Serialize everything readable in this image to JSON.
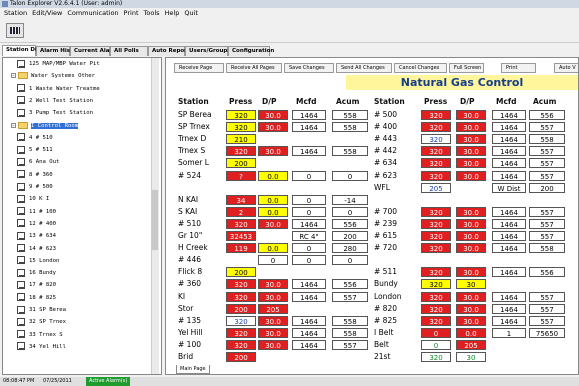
{
  "window": {
    "title": "Talon Explorer V2.6.4.1 (User: admin)"
  },
  "menu": [
    "Station",
    "Edit/View",
    "Communication",
    "Print",
    "Tools",
    "Help",
    "Quit"
  ],
  "tabs": [
    "Station Display",
    "Alarm History",
    "Current Alarms",
    "All Polls",
    "Auto Reports",
    "Users/Groups",
    "Configuration"
  ],
  "tree": [
    {
      "label": "125 MAP/MBP Water Pit",
      "level": 2,
      "type": "node"
    },
    {
      "label": "Water Systems Other",
      "level": 1,
      "type": "folder"
    },
    {
      "label": "1 Waste Water Treatme",
      "level": 2,
      "type": "node"
    },
    {
      "label": "2 Well Test Station",
      "level": 2,
      "type": "node"
    },
    {
      "label": "3 Pump Test Station",
      "level": 2,
      "type": "node"
    },
    {
      "label": "I Control Room",
      "level": 1,
      "type": "folder",
      "selected": true
    },
    {
      "label": "4 # 510",
      "level": 2,
      "type": "node"
    },
    {
      "label": "5 # 511",
      "level": 2,
      "type": "node"
    },
    {
      "label": "6 Ana Out",
      "level": 2,
      "type": "node"
    },
    {
      "label": "8 # 360",
      "level": 2,
      "type": "node"
    },
    {
      "label": "9 # 500",
      "level": 2,
      "type": "node"
    },
    {
      "label": "10 K I",
      "level": 2,
      "type": "node"
    },
    {
      "label": "11 # 100",
      "level": 2,
      "type": "node"
    },
    {
      "label": "12 # 400",
      "level": 2,
      "type": "node"
    },
    {
      "label": "13 # 634",
      "level": 2,
      "type": "node"
    },
    {
      "label": "14 # 623",
      "level": 2,
      "type": "node"
    },
    {
      "label": "15 London",
      "level": 2,
      "type": "node"
    },
    {
      "label": "16 Bundy",
      "level": 2,
      "type": "node"
    },
    {
      "label": "17 # 820",
      "level": 2,
      "type": "node"
    },
    {
      "label": "18 # 825",
      "level": 2,
      "type": "node"
    },
    {
      "label": "31 SP Berea",
      "level": 2,
      "type": "node"
    },
    {
      "label": "32 SP Trnex",
      "level": 2,
      "type": "node"
    },
    {
      "label": "33 Trnex S",
      "level": 2,
      "type": "node"
    },
    {
      "label": "34 Yel Hill",
      "level": 2,
      "type": "node"
    }
  ],
  "panel_buttons": [
    "Receive Page",
    "Receive All Pages",
    "Save Changes",
    "Send All Changes",
    "Cancel Changes",
    "Full Screen",
    "Print",
    "Auto V"
  ],
  "panel_title": "Natural Gas Control",
  "headers": [
    "Station",
    "Press",
    "D/P",
    "Mcfd",
    "Acum"
  ],
  "left_rows": [
    {
      "name": "SP Berea",
      "press": "320",
      "pc": "yel",
      "dp": "30.0",
      "dc": "red",
      "mcfd": "1464",
      "acum": "558"
    },
    {
      "name": "SP Trnex",
      "press": "320",
      "pc": "yel",
      "dp": "30.0",
      "dc": "red",
      "mcfd": "1464",
      "acum": "558"
    },
    {
      "name": "Trnex D",
      "press": "210",
      "pc": "yel",
      "dp": "",
      "dc": "",
      "mcfd": "",
      "acum": ""
    },
    {
      "name": "Trnex S",
      "press": "320",
      "pc": "red",
      "dp": "30.0",
      "dc": "red",
      "mcfd": "1464",
      "acum": "558"
    },
    {
      "name": "Somer L",
      "press": "200",
      "pc": "yel",
      "dp": "",
      "dc": "",
      "mcfd": "",
      "acum": ""
    },
    {
      "name": "# 524",
      "press": "?",
      "pc": "red",
      "dp": "0.0",
      "dc": "yel",
      "mcfd": "0",
      "acum": "0"
    },
    {
      "name": "",
      "press": "",
      "pc": "",
      "dp": "",
      "dc": "",
      "mcfd": "",
      "acum": ""
    },
    {
      "name": "N KAI",
      "press": "34",
      "pc": "red",
      "dp": "0.0",
      "dc": "yel",
      "mcfd": "0",
      "acum": "-14"
    },
    {
      "name": "S KAI",
      "press": "2",
      "pc": "red",
      "dp": "0.0",
      "dc": "yel",
      "mcfd": "0",
      "acum": "0"
    },
    {
      "name": "# 510",
      "press": "320",
      "pc": "red",
      "dp": "30.0",
      "dc": "red",
      "mcfd": "1464",
      "acum": "556"
    },
    {
      "name": "Gr 10\"",
      "press": "32453",
      "pc": "red",
      "dp": "",
      "dc": "",
      "mcfd": "RC 4\"",
      "acum": "200"
    },
    {
      "name": "H Creek",
      "press": "119",
      "pc": "red",
      "dp": "0.0",
      "dc": "yel",
      "mcfd": "0",
      "acum": "280"
    },
    {
      "name": "# 446",
      "press": "",
      "pc": "",
      "dp": "0",
      "dc": "",
      "mcfd": "0",
      "acum": "0"
    },
    {
      "name": "Flick 8",
      "press": "200",
      "pc": "yel",
      "dp": "",
      "dc": "",
      "mcfd": "",
      "acum": ""
    },
    {
      "name": "# 360",
      "press": "320",
      "pc": "red",
      "dp": "30.0",
      "dc": "red",
      "mcfd": "1464",
      "acum": "556"
    },
    {
      "name": "KI",
      "press": "320",
      "pc": "red",
      "dp": "30.0",
      "dc": "red",
      "mcfd": "1464",
      "acum": "557"
    },
    {
      "name": "Stor",
      "press": "200",
      "pc": "red",
      "dp": "205",
      "dc": "red",
      "mcfd": "",
      "acum": ""
    },
    {
      "name": "# 135",
      "press": "320",
      "pc": "blue",
      "dp": "30.0",
      "dc": "red",
      "mcfd": "1464",
      "acum": "558"
    },
    {
      "name": "Yel Hill",
      "press": "320",
      "pc": "red",
      "dp": "30.0",
      "dc": "red",
      "mcfd": "1464",
      "acum": "558"
    },
    {
      "name": "# 100",
      "press": "320",
      "pc": "red",
      "dp": "30.0",
      "dc": "red",
      "mcfd": "1464",
      "acum": "557"
    },
    {
      "name": "Brid",
      "press": "200",
      "pc": "red",
      "dp": "",
      "dc": "",
      "mcfd": "",
      "acum": ""
    }
  ],
  "right_rows": [
    {
      "name": "# 500",
      "press": "320",
      "pc": "red",
      "dp": "30.0",
      "dc": "red",
      "mcfd": "1464",
      "acum": "556"
    },
    {
      "name": "# 400",
      "press": "320",
      "pc": "red",
      "dp": "30.0",
      "dc": "red",
      "mcfd": "1464",
      "acum": "557"
    },
    {
      "name": "# 443",
      "press": "320",
      "pc": "blue",
      "dp": "30.0",
      "dc": "red",
      "mcfd": "1464",
      "acum": "558"
    },
    {
      "name": "# 442",
      "press": "320",
      "pc": "red",
      "dp": "30.0",
      "dc": "red",
      "mcfd": "1464",
      "acum": "557"
    },
    {
      "name": "# 634",
      "press": "320",
      "pc": "red",
      "dp": "30.0",
      "dc": "red",
      "mcfd": "1464",
      "acum": "557"
    },
    {
      "name": "# 623",
      "press": "320",
      "pc": "red",
      "dp": "30.0",
      "dc": "red",
      "mcfd": "1464",
      "acum": "557"
    },
    {
      "name": "WFL",
      "press": "205",
      "pc": "blue",
      "dp": "",
      "dc": "",
      "mcfd": "W Dist",
      "acum": "200"
    },
    {
      "name": "",
      "press": "",
      "pc": "",
      "dp": "",
      "dc": "",
      "mcfd": "",
      "acum": ""
    },
    {
      "name": "# 700",
      "press": "320",
      "pc": "red",
      "dp": "30.0",
      "dc": "red",
      "mcfd": "1464",
      "acum": "557"
    },
    {
      "name": "# 239",
      "press": "320",
      "pc": "red",
      "dp": "30.0",
      "dc": "red",
      "mcfd": "1464",
      "acum": "557"
    },
    {
      "name": "# 615",
      "press": "320",
      "pc": "red",
      "dp": "30.0",
      "dc": "red",
      "mcfd": "1464",
      "acum": "557"
    },
    {
      "name": "# 720",
      "press": "320",
      "pc": "red",
      "dp": "30.0",
      "dc": "red",
      "mcfd": "1464",
      "acum": "558"
    },
    {
      "name": "",
      "press": "",
      "pc": "",
      "dp": "",
      "dc": "",
      "mcfd": "",
      "acum": ""
    },
    {
      "name": "# 511",
      "press": "320",
      "pc": "red",
      "dp": "30.0",
      "dc": "red",
      "mcfd": "1464",
      "acum": "556"
    },
    {
      "name": "Bundy",
      "press": "320",
      "pc": "yel",
      "dp": "30",
      "dc": "yel",
      "mcfd": "",
      "acum": ""
    },
    {
      "name": "London",
      "press": "320",
      "pc": "red",
      "dp": "30.0",
      "dc": "red",
      "mcfd": "1464",
      "acum": "557"
    },
    {
      "name": "# 820",
      "press": "320",
      "pc": "red",
      "dp": "30.0",
      "dc": "red",
      "mcfd": "1464",
      "acum": "557"
    },
    {
      "name": "# 825",
      "press": "320",
      "pc": "red",
      "dp": "30.0",
      "dc": "red",
      "mcfd": "1464",
      "acum": "557"
    },
    {
      "name": "I Belt",
      "press": "0",
      "pc": "red",
      "dp": "0.0",
      "dc": "red",
      "mcfd": "1",
      "acum": "75650"
    },
    {
      "name": "Belt",
      "press": "0",
      "pc": "green",
      "dp": "205",
      "dc": "red",
      "mcfd": "",
      "acum": ""
    },
    {
      "name": "21st",
      "press": "320",
      "pc": "green",
      "dp": "30",
      "dc": "green",
      "mcfd": "",
      "acum": ""
    }
  ],
  "bottom_tab": "Main Page",
  "status": {
    "time": "08:08:47 PM",
    "date": "07/25/2011",
    "alarm": "Active Alarm(s)"
  },
  "colors": {
    "alarm_red": "#e02020",
    "warn_yellow": "#ffff00",
    "title_blue": "#163e8a",
    "active_green": "#1f9c2e"
  }
}
